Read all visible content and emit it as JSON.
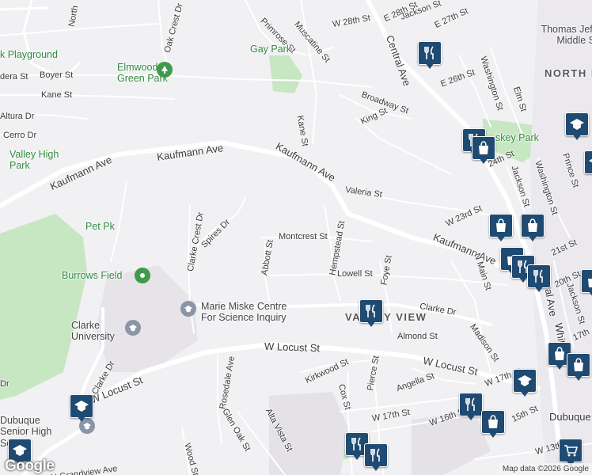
{
  "streets": {
    "w28th": "W 28th St",
    "e28th": "E 28th St",
    "jackson_top": "Jackson St",
    "e27th": "E 27th St",
    "primrose": "Primrose St",
    "muscatine": "Muscatine St",
    "oak_crest": "Oak Crest Dr",
    "north_top": "North",
    "central_ave": "Central Ave",
    "e26th": "E 26th St",
    "washington_top": "Washington St",
    "elm": "Elm St",
    "broadway": "Broadway St",
    "king": "King St",
    "dera": "dera St",
    "boyer": "Boyer St",
    "kane_w": "Kane St",
    "altura": "Altura Dr",
    "cerro": "Cerro Dr",
    "kane_n": "Kane St",
    "kaufmann_w": "Kaufmann Ave",
    "kaufmann_mid": "Kaufmann Ave",
    "kaufmann_e": "Kaufmann Ave",
    "valeria": "Valeria St",
    "w23rd": "W 23rd St",
    "w24th": "24th St",
    "jackson_mid": "Jackson St",
    "washington_mid": "Washington St",
    "prince": "Prince St",
    "clarke_crest": "Clarke Crest Dr",
    "spires": "Spires Dr",
    "montcrest": "Montcrest St",
    "abbott": "Abbott St",
    "hempstead": "Hempstead St",
    "lowell": "Lowell St",
    "foye": "Foye St",
    "n_main": "N Main St",
    "w21st": "21st St",
    "w20th": "20th St",
    "jackson_low": "Jackson St",
    "clarke_dr": "Clarke Dr",
    "almond": "Almond St",
    "madison": "Madison St",
    "w_locust_mid": "W Locust St",
    "w_locust_e": "W Locust St",
    "w_locust_w": "W Locust St",
    "central_low": "Central Ave",
    "white": "White",
    "e17th": "17th",
    "clarke_dr_w": "Clarke Dr",
    "rosedale": "Rosedale Ave",
    "kirkwood": "Kirkwood St",
    "pierce": "Pierce St",
    "angella": "Angella St",
    "w17th": "W 17th St",
    "cox": "Cox St",
    "w17th_low": "W 17th St",
    "w16th": "W 16th St",
    "w15th": "15th St",
    "glen_oak": "Glen Oak St",
    "alta_vista": "Alta Vista St",
    "wood": "Wood St",
    "w13th": "W 13th St",
    "n_grandview": "N Grandview Ave",
    "dr_w": "Dr"
  },
  "places": {
    "playground": "k Playground",
    "elmwood": "Elmwood Green Park",
    "gay_park": "Gay Park",
    "valley_high": "Valley High Park",
    "pet_pk": "Pet Pk",
    "burrows": "Burrows Field",
    "marie_miske": "Marie Miske Centre For Science Inquiry",
    "clarke_univ": "Clarke University",
    "dubuque_senior": "Dubuque Senior High School",
    "thomas_jeff": "Thomas Jeff Middle S",
    "north_end": "NORTH E",
    "comiskey": "skey Park",
    "valley_view": "VALLEY VIEW",
    "dubuque_city": "Dubuque"
  },
  "map": {
    "brand": "Google",
    "attribution": "Map data ©2026 Google"
  },
  "colors": {
    "background": "#f1f0f2",
    "park": "#c7e6c2",
    "road": "#ffffff",
    "marker": "#1f4a72",
    "park_pin": "#3f9a4b",
    "school_pin": "#8a96a8"
  }
}
